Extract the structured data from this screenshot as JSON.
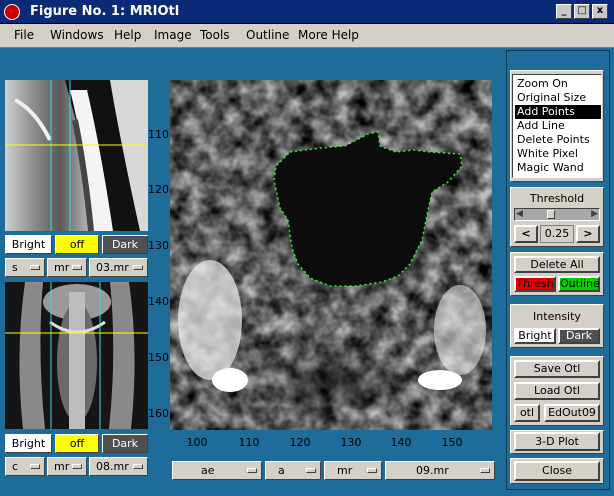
{
  "window": {
    "title": "Figure No. 1: MRIOtl",
    "min_label": "_",
    "max_label": "□",
    "close_label": "x"
  },
  "menu": {
    "items": [
      "File",
      "Windows",
      "Help",
      "Image",
      "Tools",
      "Outline",
      "More Help"
    ]
  },
  "top_thumb": {
    "bright": "Bright",
    "off": "off",
    "dark": "Dark",
    "popups": [
      "s",
      "mr",
      "03.mr"
    ]
  },
  "bottom_thumb": {
    "bright": "Bright",
    "off": "off",
    "dark": "Dark",
    "popups": [
      "c",
      "mr",
      "08.mr"
    ]
  },
  "main": {
    "y_ticks": [
      "110",
      "120",
      "130",
      "140",
      "150",
      "160"
    ],
    "x_ticks": [
      "100",
      "110",
      "120",
      "130",
      "140",
      "150"
    ],
    "popups": [
      "ae",
      "a",
      "mr",
      "09.mr"
    ]
  },
  "tools": {
    "items": [
      "Zoom On",
      "Original Size",
      "Add Points",
      "Add Line",
      "Delete Points",
      "White Pixel",
      "Magic Wand"
    ],
    "selected": "Add Points"
  },
  "threshold": {
    "label": "Threshold",
    "value": "0.25",
    "slider_fraction": 0.35,
    "dec": "<",
    "inc": ">"
  },
  "actions": {
    "delete_all": "Delete All",
    "thresh": "Thresh",
    "outline": "Outline",
    "intensity": "Intensity",
    "bright": "Bright",
    "dark": "Dark",
    "save": "Save Otl",
    "load": "Load Otl",
    "otl": "otl",
    "edout": "EdOut09",
    "plot3d": "3-D Plot",
    "close": "Close"
  },
  "colors": {
    "title_bg": "#0a2a78",
    "accent_yellow": "#ffff00",
    "thresh_red": "#e00000",
    "outline_green": "#00d000",
    "outline_trace": "#2cf02c"
  }
}
